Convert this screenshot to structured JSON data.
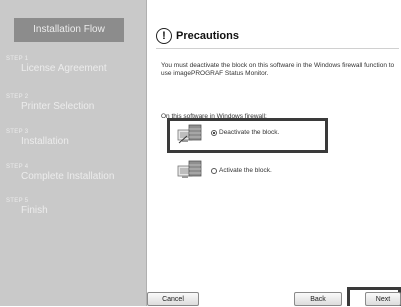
{
  "sidebar": {
    "header": "Installation Flow",
    "steps": [
      {
        "num": "STEP 1",
        "name": "License Agreement"
      },
      {
        "num": "STEP 2",
        "name": "Printer Selection"
      },
      {
        "num": "STEP 3",
        "name": "Installation"
      },
      {
        "num": "STEP 4",
        "name": "Complete Installation"
      },
      {
        "num": "STEP 5",
        "name": "Finish"
      }
    ]
  },
  "main": {
    "title": "Precautions",
    "message": "You must deactivate the block on this software in the Windows firewall function to use imagePROGRAF Status Monitor.",
    "subhead": "On this software in Windows firewall:",
    "options": [
      {
        "label": "Deactivate the block.",
        "selected": true
      },
      {
        "label": "Activate the block.",
        "selected": false
      }
    ]
  },
  "buttons": {
    "cancel": "Cancel",
    "back": "Back",
    "next": "Next"
  },
  "icons": {
    "title": "exclamation-icon",
    "option_1": "firewall-computer-icon",
    "option_2": "firewall-computer-icon"
  }
}
